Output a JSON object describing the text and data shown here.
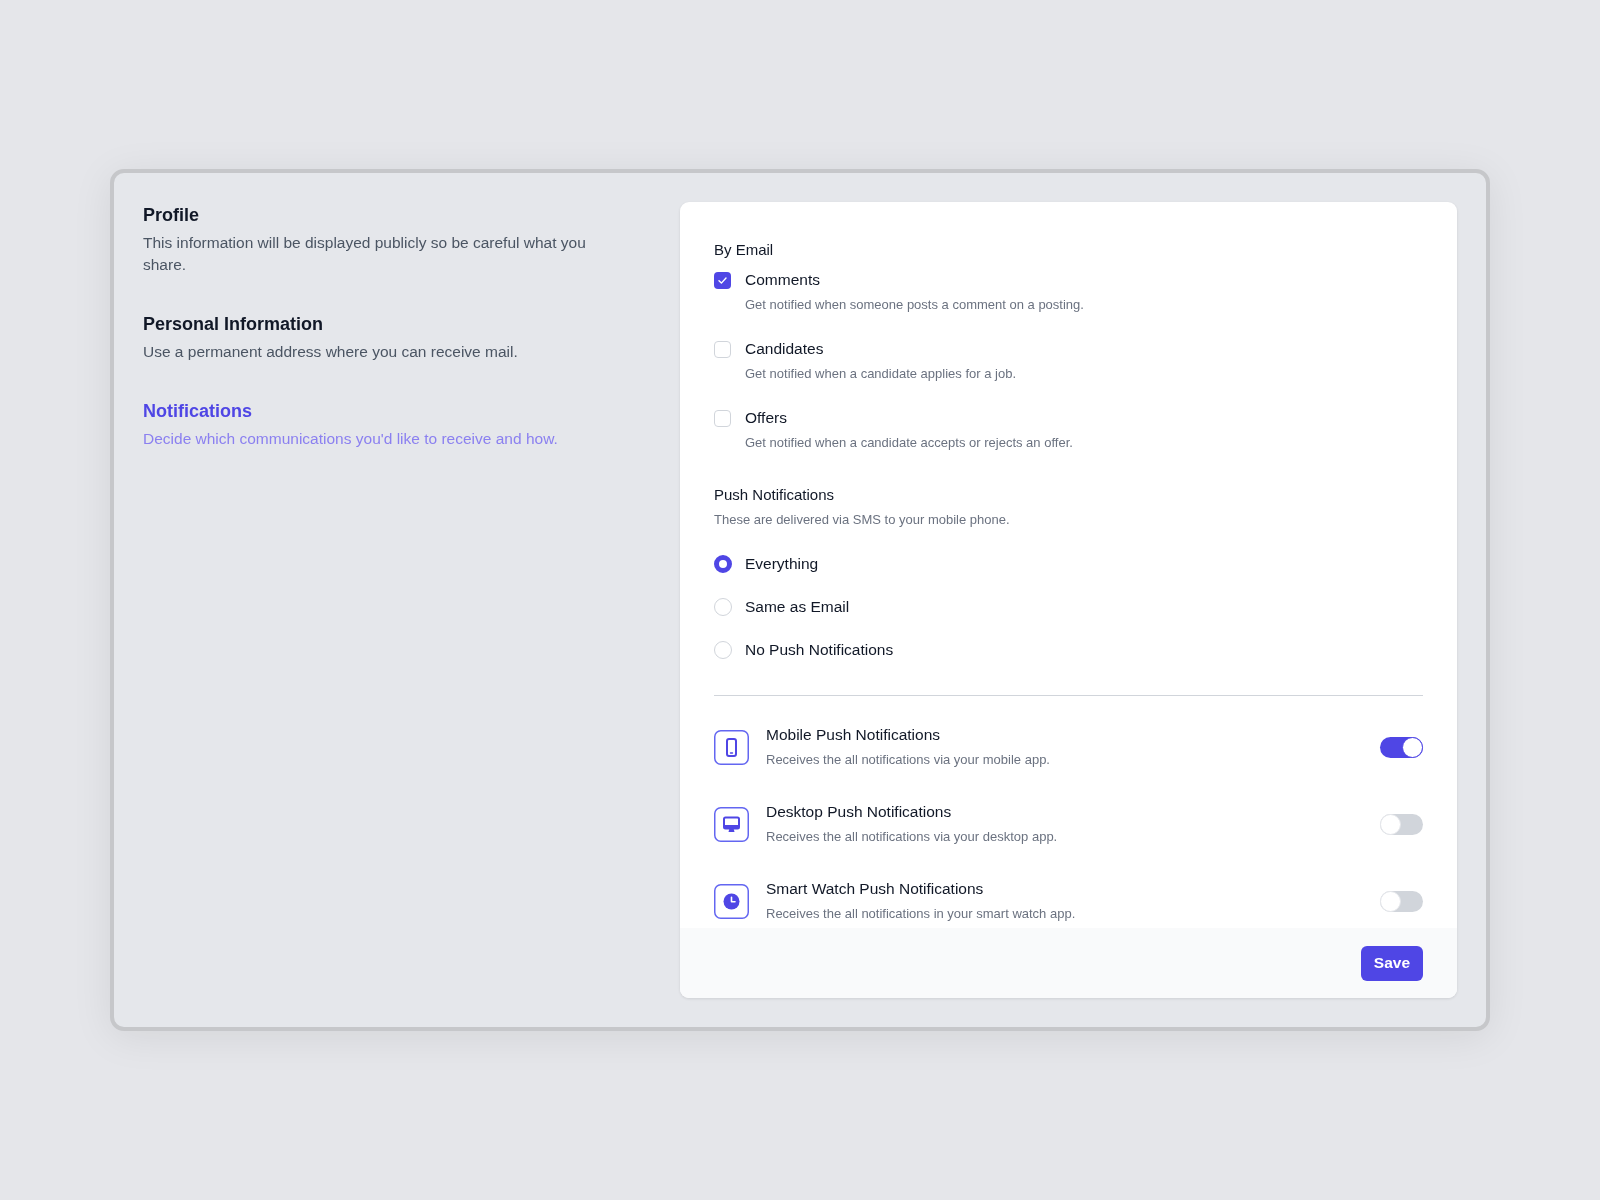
{
  "sidebar": {
    "items": [
      {
        "title": "Profile",
        "description": "This information will be displayed publicly so be careful what you share.",
        "selected": false
      },
      {
        "title": "Personal Information",
        "description": "Use a permanent address where you can receive mail.",
        "selected": false
      },
      {
        "title": "Notifications",
        "description": "Decide which communications you'd like to receive and how.",
        "selected": true
      }
    ]
  },
  "email": {
    "heading": "By Email",
    "options": [
      {
        "label": "Comments",
        "description": "Get notified when someone posts a comment on a posting.",
        "checked": true
      },
      {
        "label": "Candidates",
        "description": "Get notified when a candidate applies for a job.",
        "checked": false
      },
      {
        "label": "Offers",
        "description": "Get notified when a candidate accepts or rejects an offer.",
        "checked": false
      }
    ]
  },
  "push": {
    "heading": "Push Notifications",
    "description": "These are delivered via SMS to your mobile phone.",
    "options": [
      {
        "label": "Everything",
        "selected": true
      },
      {
        "label": "Same as Email",
        "selected": false
      },
      {
        "label": "No Push Notifications",
        "selected": false
      }
    ]
  },
  "devices": [
    {
      "kind": "mobile",
      "title": "Mobile Push Notifications",
      "description": "Receives the all notifications via your mobile app.",
      "on": true
    },
    {
      "kind": "desktop",
      "title": "Desktop Push Notifications",
      "description": "Receives the all notifications via your desktop app.",
      "on": false
    },
    {
      "kind": "watch",
      "title": "Smart Watch Push Notifications",
      "description": "Receives the all notifications in your smart watch app.",
      "on": false
    }
  ],
  "footer": {
    "button": "Save"
  }
}
